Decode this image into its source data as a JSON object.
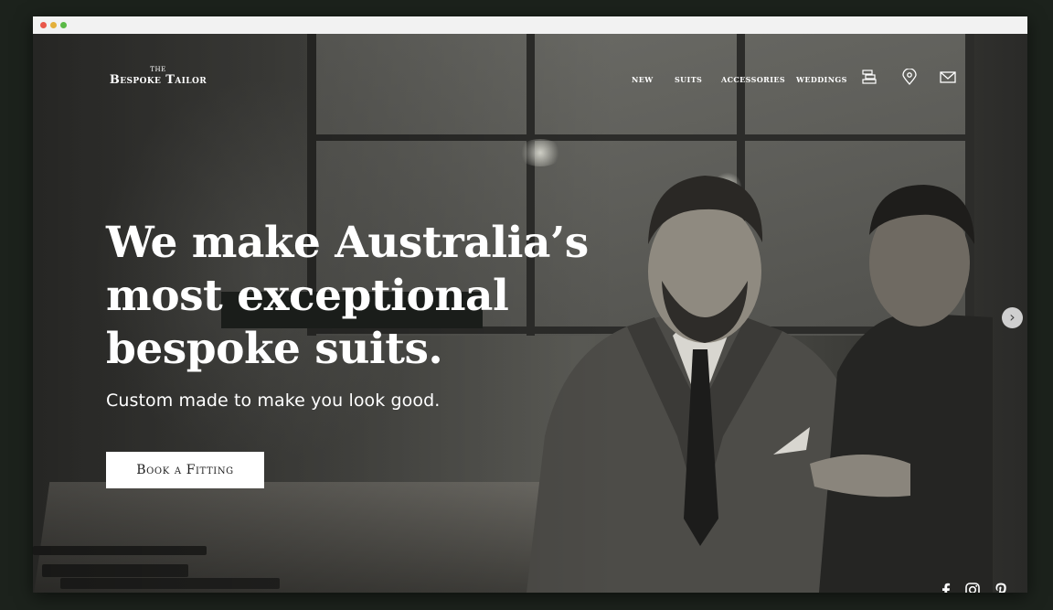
{
  "brand": {
    "the": "THE",
    "name": "Bespoke Tailor"
  },
  "nav": {
    "items": [
      "NEW",
      "SUITS",
      "ACCESSORIES",
      "WEDDINGS"
    ]
  },
  "nav_icons": [
    "measure-icon",
    "location-pin-icon",
    "mail-icon"
  ],
  "hero": {
    "headline": [
      "We make Australia’s",
      "most exceptional",
      "bespoke suits."
    ],
    "subheadline": "Custom made to make you look good.",
    "cta_label": "Book a Fitting"
  },
  "carousel": {
    "next_icon": "chevron-right-icon",
    "next_glyph": "›"
  },
  "social": [
    "facebook-icon",
    "instagram-icon",
    "pinterest-icon"
  ],
  "colors": {
    "background": "#1c221c",
    "text": "#ffffff",
    "highlight": "#1a1d1a"
  }
}
